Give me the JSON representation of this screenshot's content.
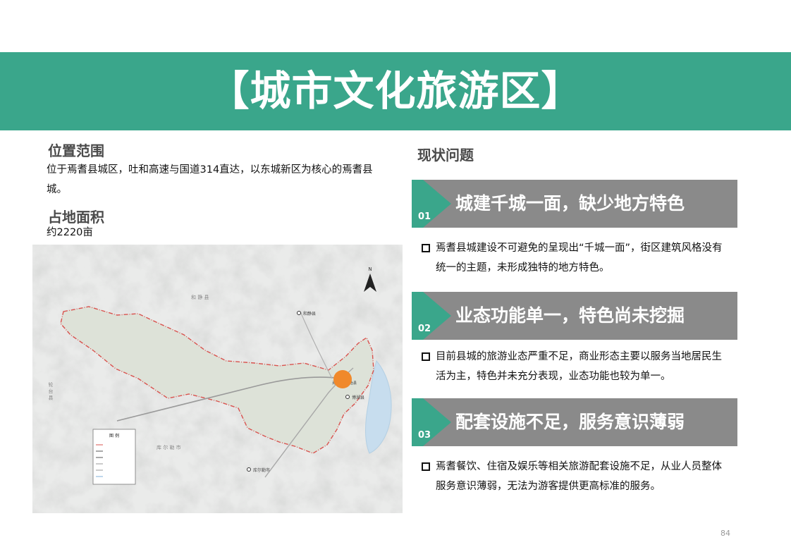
{
  "banner": {
    "title": "【城市文化旅游区】"
  },
  "location": {
    "heading": "位置范围",
    "text": "位于焉耆县城区，吐和高速与国道314直达，以东城新区为核心的焉耆县城。"
  },
  "area": {
    "heading": "占地面积",
    "value": "约2220亩"
  },
  "map": {
    "north_label": "N",
    "place_labels": {
      "hejing_region": "和 静 县",
      "hejing_county": "和静县",
      "kuerle_region": "库 尔 勒 市",
      "kuerle_city": "库尔勒市",
      "luntai": "轮 台 县",
      "bohu": "博湖县",
      "yanqi": "焉耆回族自治县"
    },
    "legend_title": "图 例",
    "accent_color": "#f0892b",
    "boundary_color": "#d9534f"
  },
  "issues": {
    "heading": "现状问题",
    "items": [
      {
        "num": "01",
        "title": "城建千城一面，缺少地方特色",
        "desc": "焉耆县城建设不可避免的呈现出“千城一面”，街区建筑风格没有统一的主题，未形成独特的地方特色。"
      },
      {
        "num": "02",
        "title": "业态功能单一，特色尚未挖掘",
        "desc": "目前县城的旅游业态严重不足，商业形态主要以服务当地居民生活为主，特色并未充分表现，业态功能也较为单一。"
      },
      {
        "num": "03",
        "title": "配套设施不足，服务意识薄弱",
        "desc": "焉耆餐饮、住宿及娱乐等相关旅游配套设施不足，从业人员整体服务意识薄弱，无法为游客提供更高标准的服务。"
      }
    ]
  },
  "colors": {
    "accent_green": "#3aa68b",
    "issue_gray": "#8a8a8a"
  },
  "page_number": "84"
}
